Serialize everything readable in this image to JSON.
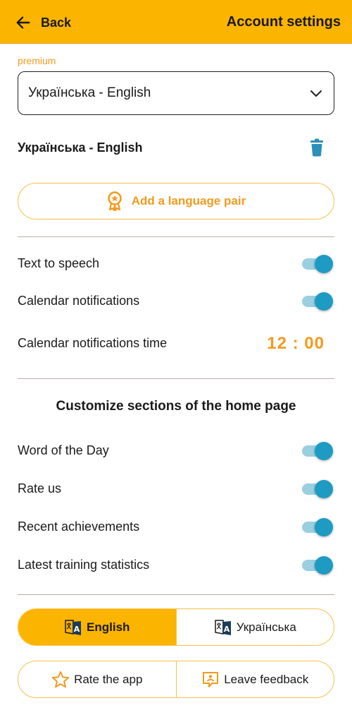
{
  "header": {
    "back_label": "Back",
    "title": "Account settings",
    "back_icon": "arrow-left-icon"
  },
  "language": {
    "premium_label": "premium",
    "selected_pair": "Українська - English",
    "pairs": [
      "Українська - English"
    ],
    "add_pair_label": "Add a language pair",
    "delete_icon": "trash-icon"
  },
  "settings": {
    "text_to_speech": {
      "label": "Text to speech",
      "enabled": true
    },
    "calendar_notifications": {
      "label": "Calendar notifications",
      "enabled": true
    },
    "notification_time": {
      "label": "Calendar notifications time",
      "value": "12 : 00"
    }
  },
  "home_sections": {
    "title": "Customize sections of the home page",
    "items": [
      {
        "label": "Word of the Day",
        "enabled": true
      },
      {
        "label": "Rate us",
        "enabled": true
      },
      {
        "label": "Recent achievements",
        "enabled": true
      },
      {
        "label": "Latest training statistics",
        "enabled": true
      }
    ]
  },
  "interface_language": {
    "options": [
      "English",
      "Українська"
    ],
    "selected": "English"
  },
  "feedback": {
    "rate_label": "Rate the app",
    "feedback_label": "Leave feedback"
  },
  "colors": {
    "accent": "#FBB400",
    "accent_text": "#F39A1E",
    "toggle_on": "#1E9BC2",
    "trash": "#2B8FB8"
  }
}
